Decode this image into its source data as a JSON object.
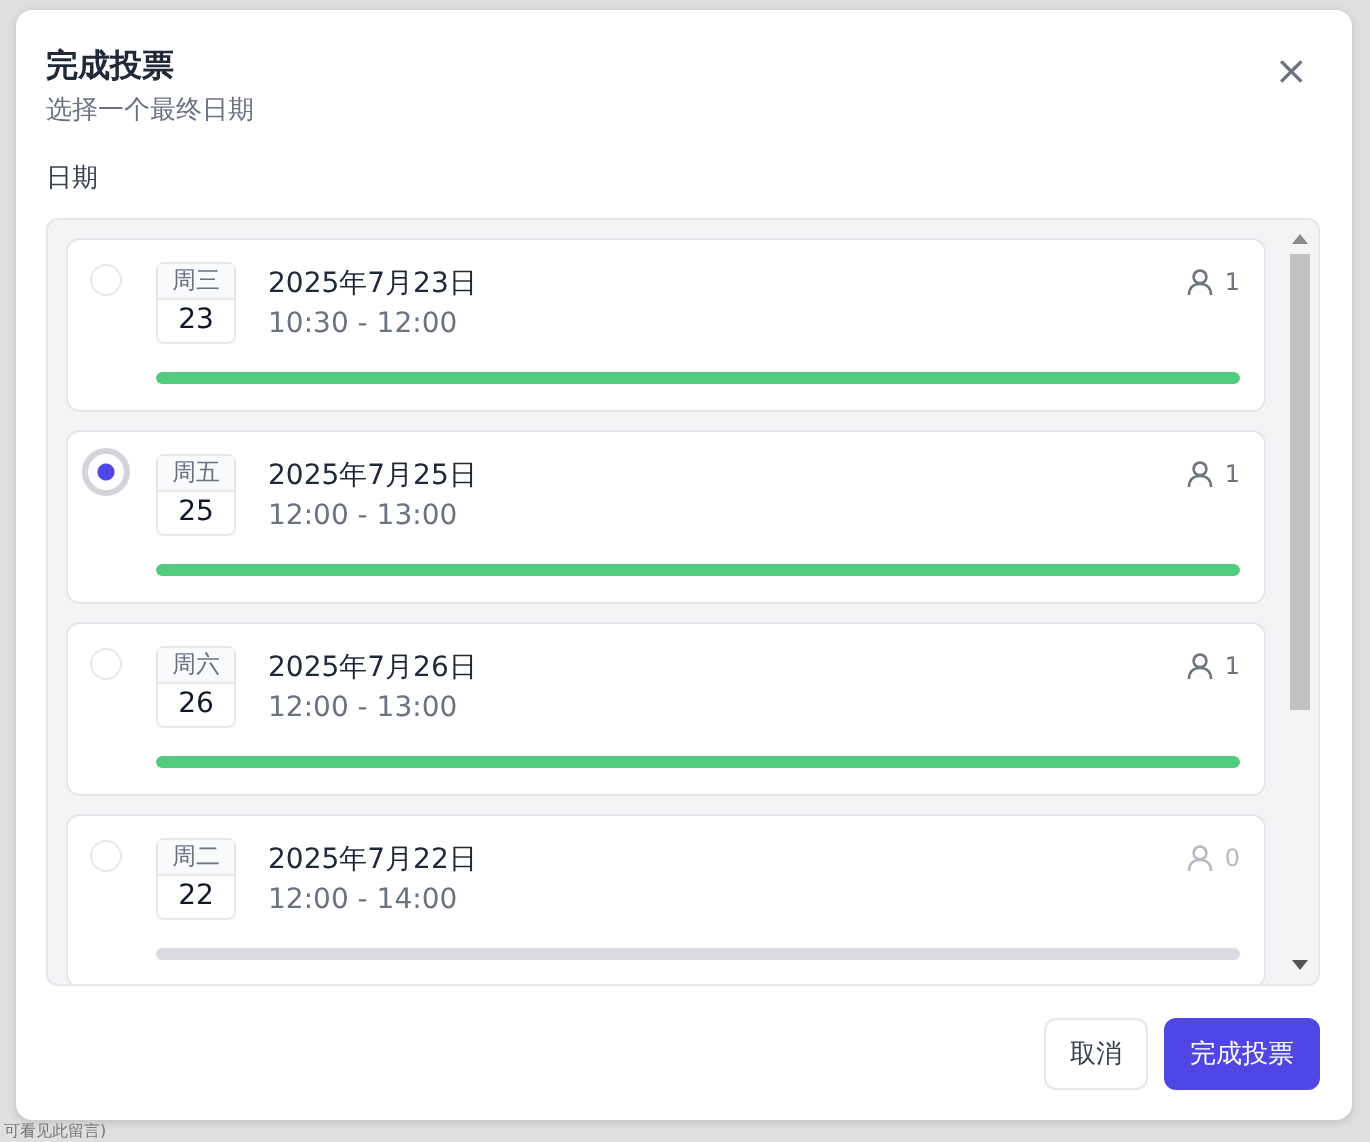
{
  "background": {
    "note": "可看见此留言)"
  },
  "dialog": {
    "title": "完成投票",
    "subtitle": "选择一个最终日期",
    "close": "×",
    "field_label": "日期",
    "options": [
      {
        "weekday": "周三",
        "day": "23",
        "date": "2025年7月23日",
        "time": "10:30 - 12:00",
        "votes": "1",
        "level": 1,
        "selected": false
      },
      {
        "weekday": "周五",
        "day": "25",
        "date": "2025年7月25日",
        "time": "12:00 - 13:00",
        "votes": "1",
        "level": 1,
        "selected": true
      },
      {
        "weekday": "周六",
        "day": "26",
        "date": "2025年7月26日",
        "time": "12:00 - 13:00",
        "votes": "1",
        "level": 1,
        "selected": false
      },
      {
        "weekday": "周二",
        "day": "22",
        "date": "2025年7月22日",
        "time": "12:00 - 14:00",
        "votes": "0",
        "level": 0,
        "selected": false
      }
    ],
    "buttons": [
      {
        "label": "取消",
        "kind": "secondary"
      },
      {
        "label": "完成投票",
        "kind": "primary"
      }
    ]
  }
}
